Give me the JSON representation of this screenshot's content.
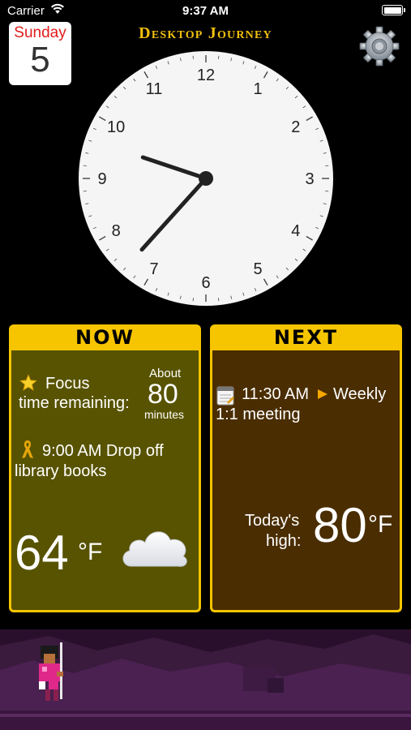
{
  "status_bar": {
    "carrier": "Carrier",
    "time": "9:37 AM"
  },
  "calendar": {
    "weekday": "Sunday",
    "day": "5"
  },
  "app": {
    "title": "Desktop Journey"
  },
  "clock": {
    "hour": 9,
    "minute": 37,
    "numbers": [
      "12",
      "1",
      "2",
      "3",
      "4",
      "5",
      "6",
      "7",
      "8",
      "9",
      "10",
      "11"
    ]
  },
  "now_panel": {
    "header": "NOW",
    "focus_icon": "star-icon",
    "focus_line1": "Focus",
    "focus_line2": "time remaining:",
    "about": "About",
    "minutes_value": "80",
    "minutes_unit": "minutes",
    "event_icon": "ribbon-icon",
    "event_line1": "9:00 AM Drop off",
    "event_line2": "library books",
    "temperature": "64",
    "temperature_unit": "°F",
    "weather_icon": "cloud-icon"
  },
  "next_panel": {
    "header": "NEXT",
    "event_icon": "notepad-icon",
    "event_time": "11:30 AM",
    "arrow_icon": "play-arrow-icon",
    "event_title_1": "Weekly",
    "event_title_2": "1:1 meeting",
    "high_label_1": "Today's",
    "high_label_2": "high:",
    "high_value": "80",
    "high_unit": "°F"
  },
  "colors": {
    "accent": "#f6c500",
    "title": "#f2c00d",
    "now_bg": "#585300",
    "next_bg": "#4a2d00"
  }
}
